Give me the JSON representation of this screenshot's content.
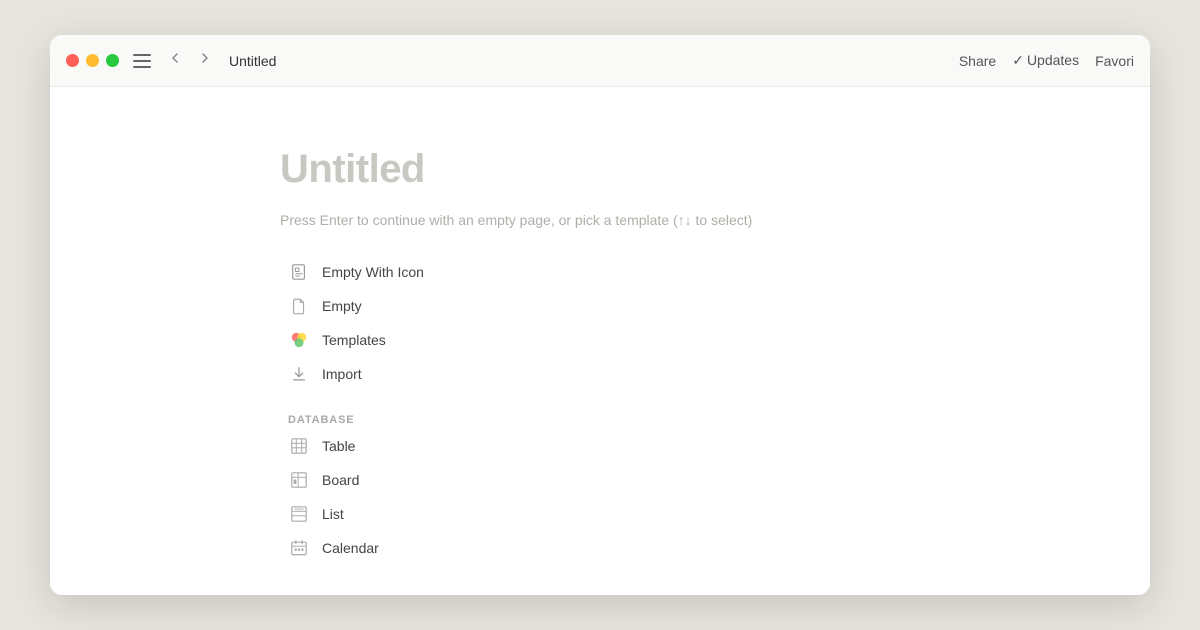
{
  "window": {
    "title": "Untitled"
  },
  "titlebar": {
    "share_label": "Share",
    "updates_label": "Updates",
    "favorites_label": "Favori",
    "back_label": "←",
    "forward_label": "→"
  },
  "page": {
    "heading": "Untitled",
    "hint": "Press Enter to continue with an empty page, or pick a template (↑↓ to select)"
  },
  "menu_items": [
    {
      "id": "empty-with-icon",
      "label": "Empty With Icon",
      "icon_type": "document-with-icon"
    },
    {
      "id": "empty",
      "label": "Empty",
      "icon_type": "document"
    },
    {
      "id": "templates",
      "label": "Templates",
      "icon_type": "colorful-template"
    },
    {
      "id": "import",
      "label": "Import",
      "icon_type": "download"
    }
  ],
  "database_label": "DATABASE",
  "database_items": [
    {
      "id": "table",
      "label": "Table",
      "icon_type": "table"
    },
    {
      "id": "board",
      "label": "Board",
      "icon_type": "board"
    },
    {
      "id": "list",
      "label": "List",
      "icon_type": "list"
    },
    {
      "id": "calendar",
      "label": "Calendar",
      "icon_type": "calendar"
    }
  ]
}
